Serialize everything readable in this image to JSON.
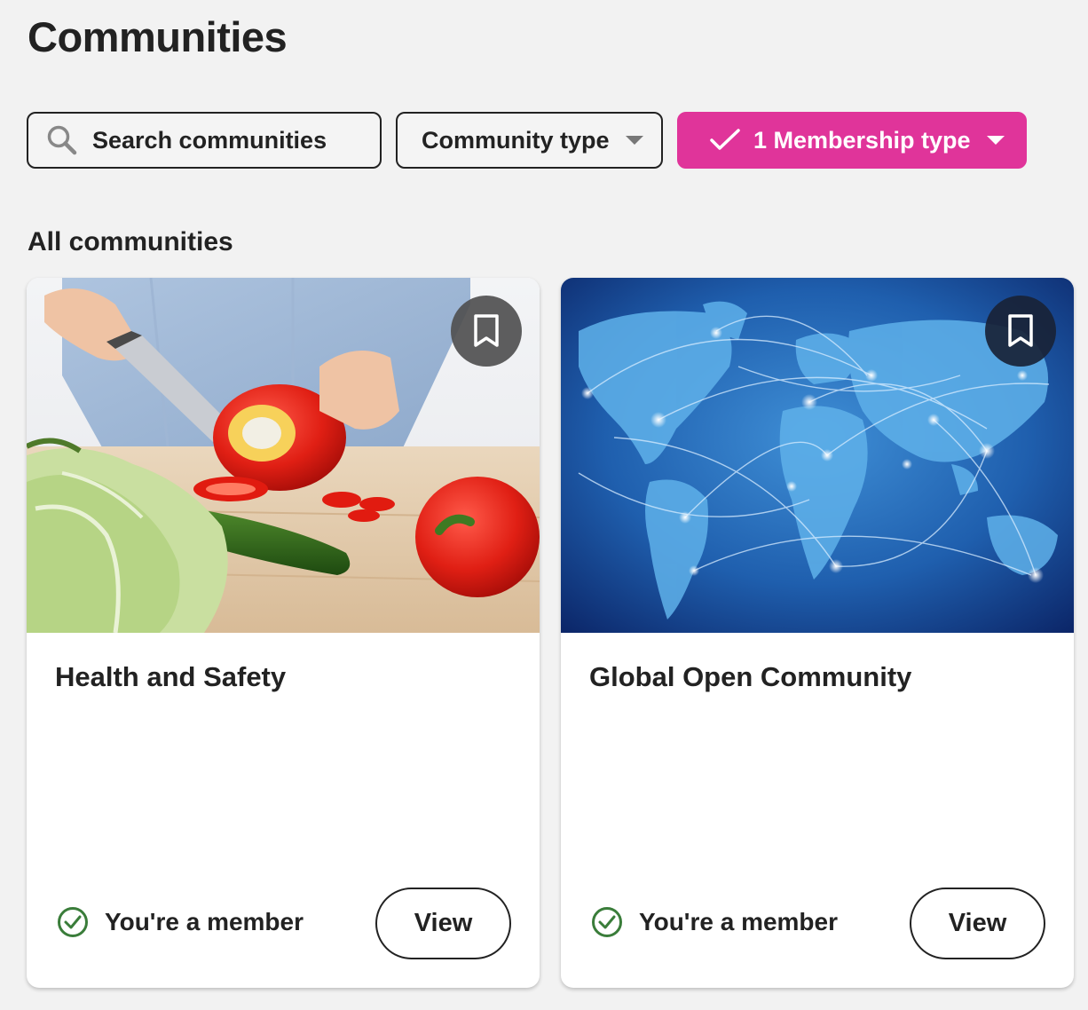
{
  "page": {
    "title": "Communities"
  },
  "filters": {
    "search_placeholder": "Search communities",
    "community_type_label": "Community type",
    "membership_type_label": "1 Membership type",
    "active_color": "#e0349a"
  },
  "section": {
    "title": "All communities"
  },
  "communities": [
    {
      "title": "Health and Safety",
      "image": "photo of hands slicing a red bell pepper with a knife beside cucumber and lettuce",
      "status": "You're a member",
      "view_label": "View"
    },
    {
      "title": "Global Open Community",
      "image": "glowing network connections over a blue world map",
      "status": "You're a member",
      "view_label": "View"
    }
  ],
  "icons": {
    "search": "search-icon",
    "check": "check-icon",
    "bookmark": "bookmark-icon",
    "member": "check-circle-icon",
    "dropdown": "chevron-down-icon"
  },
  "colors": {
    "background": "#f2f2f2",
    "member_check": "#3a7d3a",
    "text": "#222222"
  }
}
